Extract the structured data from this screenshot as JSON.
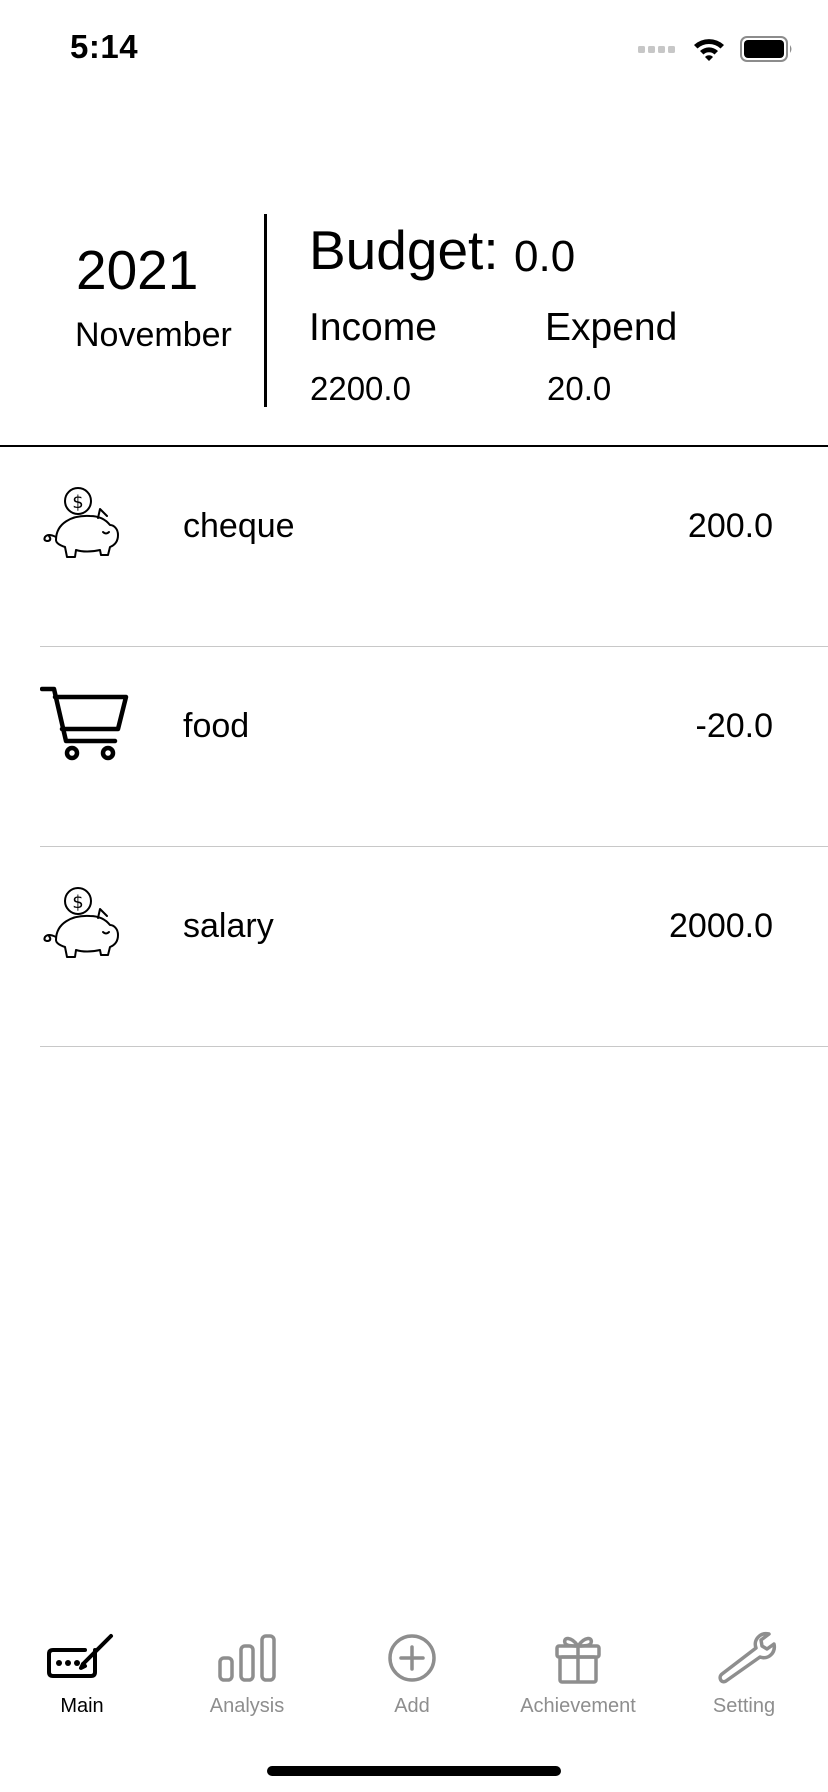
{
  "status_bar": {
    "time": "5:14",
    "icons": [
      "cellular-signal-icon",
      "wifi-icon",
      "battery-icon"
    ]
  },
  "summary": {
    "year": "2021",
    "month": "November",
    "budget_label": "Budget:",
    "budget_value": "0.0",
    "income_label": "Income",
    "income_value": "2200.0",
    "expend_label": "Expend",
    "expend_value": "20.0"
  },
  "transactions": [
    {
      "icon": "piggy-bank-icon",
      "name": "cheque",
      "amount": "200.0"
    },
    {
      "icon": "shopping-cart-icon",
      "name": "food",
      "amount": "-20.0"
    },
    {
      "icon": "piggy-bank-icon",
      "name": "salary",
      "amount": "2000.0"
    }
  ],
  "tabs": [
    {
      "icon": "edit-card-icon",
      "label": "Main",
      "active": true
    },
    {
      "icon": "bar-chart-icon",
      "label": "Analysis",
      "active": false
    },
    {
      "icon": "plus-circle-icon",
      "label": "Add",
      "active": false
    },
    {
      "icon": "gift-icon",
      "label": "Achievement",
      "active": false
    },
    {
      "icon": "wrench-icon",
      "label": "Setting",
      "active": false
    }
  ],
  "colors": {
    "active_tab": "#000000",
    "inactive_tab": "#8e8e8e",
    "separator": "#c8c8c8"
  }
}
